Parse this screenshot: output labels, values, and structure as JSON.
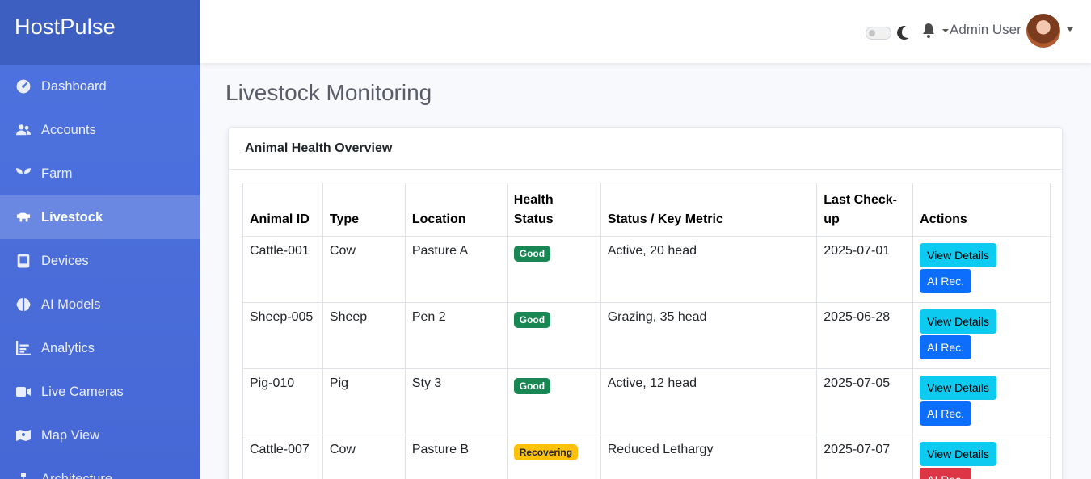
{
  "app": {
    "title": "HostPulse"
  },
  "sidebar": {
    "items": [
      {
        "label": "Dashboard",
        "icon": "dashboard-icon",
        "active": false
      },
      {
        "label": "Accounts",
        "icon": "users-icon",
        "active": false
      },
      {
        "label": "Farm",
        "icon": "seedling-icon",
        "active": false
      },
      {
        "label": "Livestock",
        "icon": "cow-icon",
        "active": true
      },
      {
        "label": "Devices",
        "icon": "tablet-icon",
        "active": false
      },
      {
        "label": "AI Models",
        "icon": "brain-icon",
        "active": false
      },
      {
        "label": "Analytics",
        "icon": "chart-line-icon",
        "active": false
      },
      {
        "label": "Live Cameras",
        "icon": "video-icon",
        "active": false
      },
      {
        "label": "Map View",
        "icon": "map-icon",
        "active": false
      },
      {
        "label": "Architecture",
        "icon": "sitemap-icon",
        "active": false
      }
    ]
  },
  "topbar": {
    "user_name": "Admin User"
  },
  "page": {
    "title": "Livestock Monitoring"
  },
  "card": {
    "title": "Animal Health Overview",
    "columns": [
      "Animal ID",
      "Type",
      "Location",
      "Health Status",
      "Status / Key Metric",
      "Last Check-up",
      "Actions"
    ],
    "rows": [
      {
        "id": "Cattle-001",
        "type": "Cow",
        "location": "Pasture A",
        "health": "Good",
        "health_level": "good",
        "metric": "Active, 20 head",
        "checkup": "2025-07-01",
        "view": "View Details",
        "ai": "AI Rec.",
        "ai_style": "primary"
      },
      {
        "id": "Sheep-005",
        "type": "Sheep",
        "location": "Pen 2",
        "health": "Good",
        "health_level": "good",
        "metric": "Grazing, 35 head",
        "checkup": "2025-06-28",
        "view": "View Details",
        "ai": "AI Rec.",
        "ai_style": "primary"
      },
      {
        "id": "Pig-010",
        "type": "Pig",
        "location": "Sty 3",
        "health": "Good",
        "health_level": "good",
        "metric": "Active, 12 head",
        "checkup": "2025-07-05",
        "view": "View Details",
        "ai": "AI Rec.",
        "ai_style": "primary"
      },
      {
        "id": "Cattle-007",
        "type": "Cow",
        "location": "Pasture B",
        "health": "Recovering",
        "health_level": "warn",
        "metric": "Reduced Lethargy",
        "checkup": "2025-07-07",
        "view": "View Details",
        "ai": "AI Rec.",
        "ai_style": "danger"
      }
    ]
  },
  "colors": {
    "sidebar": "#4e73df",
    "brand_bg": "#3d5fc2",
    "badge_good": "#198754",
    "badge_warn": "#ffc107",
    "btn_info": "#0dcaf0",
    "btn_primary": "#0d6efd",
    "btn_danger": "#dc3545"
  }
}
